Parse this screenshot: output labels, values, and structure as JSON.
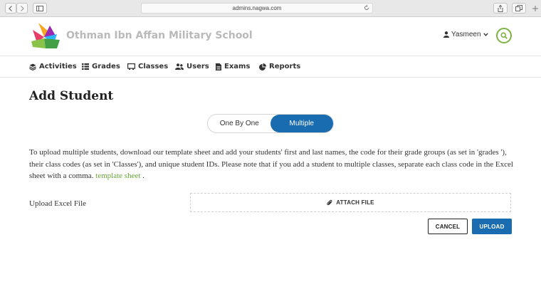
{
  "browser": {
    "url": "admins.nagwa.com"
  },
  "header": {
    "school_name": "Othman Ibn Affan Military School",
    "user_name": "Yasmeen"
  },
  "nav": [
    {
      "label": "Activities",
      "icon": "layers-icon"
    },
    {
      "label": "Grades",
      "icon": "list-icon"
    },
    {
      "label": "Classes",
      "icon": "chalkboard-icon"
    },
    {
      "label": "Users",
      "icon": "users-icon"
    },
    {
      "label": "Exams",
      "icon": "document-icon"
    },
    {
      "label": "Reports",
      "icon": "pie-chart-icon"
    }
  ],
  "main": {
    "title": "Add Student",
    "toggle": {
      "option_one": "One By One",
      "option_multiple": "Multiple",
      "selected": "Multiple"
    },
    "description": "To upload multiple students, download our template sheet and add your students' first and last names, the code for their grade groups (as set in 'grades '), their class codes (as set in 'Classes'), and unique student IDs. Please note that if you add a student to multiple classes, separate each class code in the Excel sheet with a comma.",
    "template_link": "template sheet",
    "description_end": ".",
    "upload_label": "Upload Excel File",
    "attach_label": "ATTACH FILE",
    "cancel_label": "CANCEL",
    "upload_button": "UPLOAD"
  },
  "colors": {
    "accent_blue": "#1a6cb0",
    "accent_green": "#7cb342",
    "link_green": "#6aa539"
  }
}
